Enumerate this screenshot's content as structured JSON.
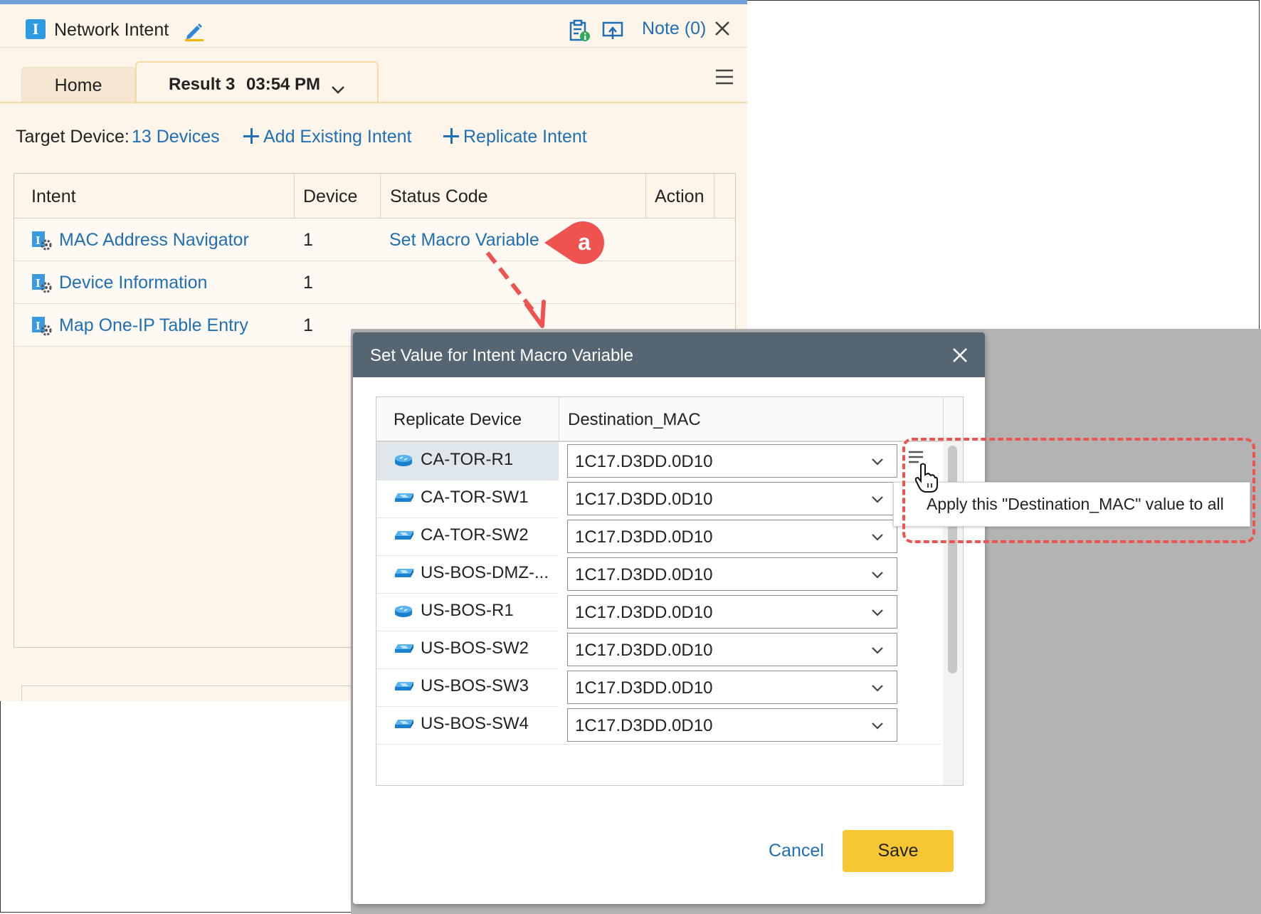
{
  "window": {
    "title": "Network Intent",
    "note_label": "Note (0)"
  },
  "tabs": {
    "home": "Home",
    "result_label": "Result 3",
    "result_time": "03:54 PM"
  },
  "toolbar": {
    "target_label": "Target Device:",
    "target_count": "13 Devices",
    "add_existing": "Add Existing Intent",
    "replicate": "Replicate Intent"
  },
  "intent_table": {
    "headers": [
      "Intent",
      "Device",
      "Status Code",
      "Action"
    ],
    "rows": [
      {
        "intent": "MAC Address Navigator",
        "device": "1",
        "status": "Set Macro Variable"
      },
      {
        "intent": "Device Information",
        "device": "1",
        "status": ""
      },
      {
        "intent": "Map One-IP Table Entry",
        "device": "1",
        "status": ""
      }
    ]
  },
  "callout": {
    "label": "a",
    "color": "#ef5350"
  },
  "dialog": {
    "title": "Set Value for Intent Macro Variable",
    "headers": [
      "Replicate Device",
      "Destination_MAC"
    ],
    "rows": [
      {
        "device": "CA-TOR-R1",
        "type": "router",
        "value": "1C17.D3DD.0D10"
      },
      {
        "device": "CA-TOR-SW1",
        "type": "switch",
        "value": "1C17.D3DD.0D10"
      },
      {
        "device": "CA-TOR-SW2",
        "type": "switch",
        "value": "1C17.D3DD.0D10"
      },
      {
        "device": "US-BOS-DMZ-...",
        "type": "switch",
        "value": "1C17.D3DD.0D10"
      },
      {
        "device": "US-BOS-R1",
        "type": "router",
        "value": "1C17.D3DD.0D10"
      },
      {
        "device": "US-BOS-SW2",
        "type": "switch",
        "value": "1C17.D3DD.0D10"
      },
      {
        "device": "US-BOS-SW3",
        "type": "switch",
        "value": "1C17.D3DD.0D10"
      },
      {
        "device": "US-BOS-SW4",
        "type": "switch",
        "value": "1C17.D3DD.0D10"
      }
    ],
    "tooltip": "Apply this \"Destination_MAC\" value to all",
    "cancel": "Cancel",
    "save": "Save"
  },
  "colors": {
    "link": "#1f6fb5",
    "panel_bg": "#fdf5ea",
    "dialog_header": "#566572",
    "save_button": "#f7c633",
    "highlight": "#ef5350"
  }
}
